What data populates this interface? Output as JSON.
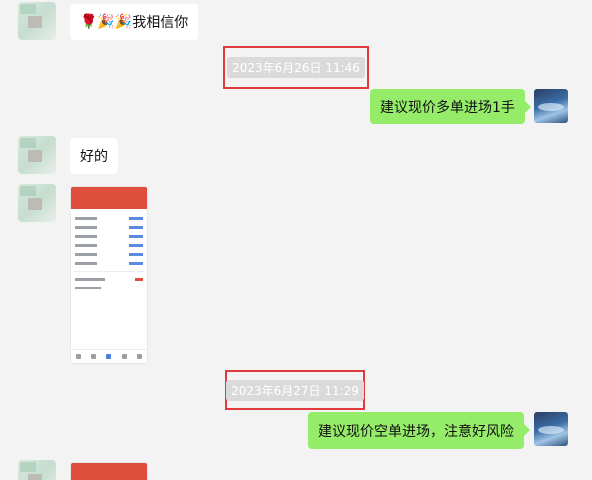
{
  "messages": {
    "m1_text": "我相信你",
    "m1_emoji": "🌹🎉🎉",
    "ts1": "2023年6月26日 11:46",
    "m2_text": "建议现价多单进场1手",
    "m3_text": "好的",
    "ts2": "2023年6月27日 11:29",
    "m4_text": "建议现价空单进场，注意好风险"
  },
  "colors": {
    "background": "#f3f3f3",
    "outgoing_bubble": "#95ec69",
    "incoming_bubble": "#ffffff",
    "highlight_box": "#e03a3a",
    "app_header": "#e04e3e"
  }
}
